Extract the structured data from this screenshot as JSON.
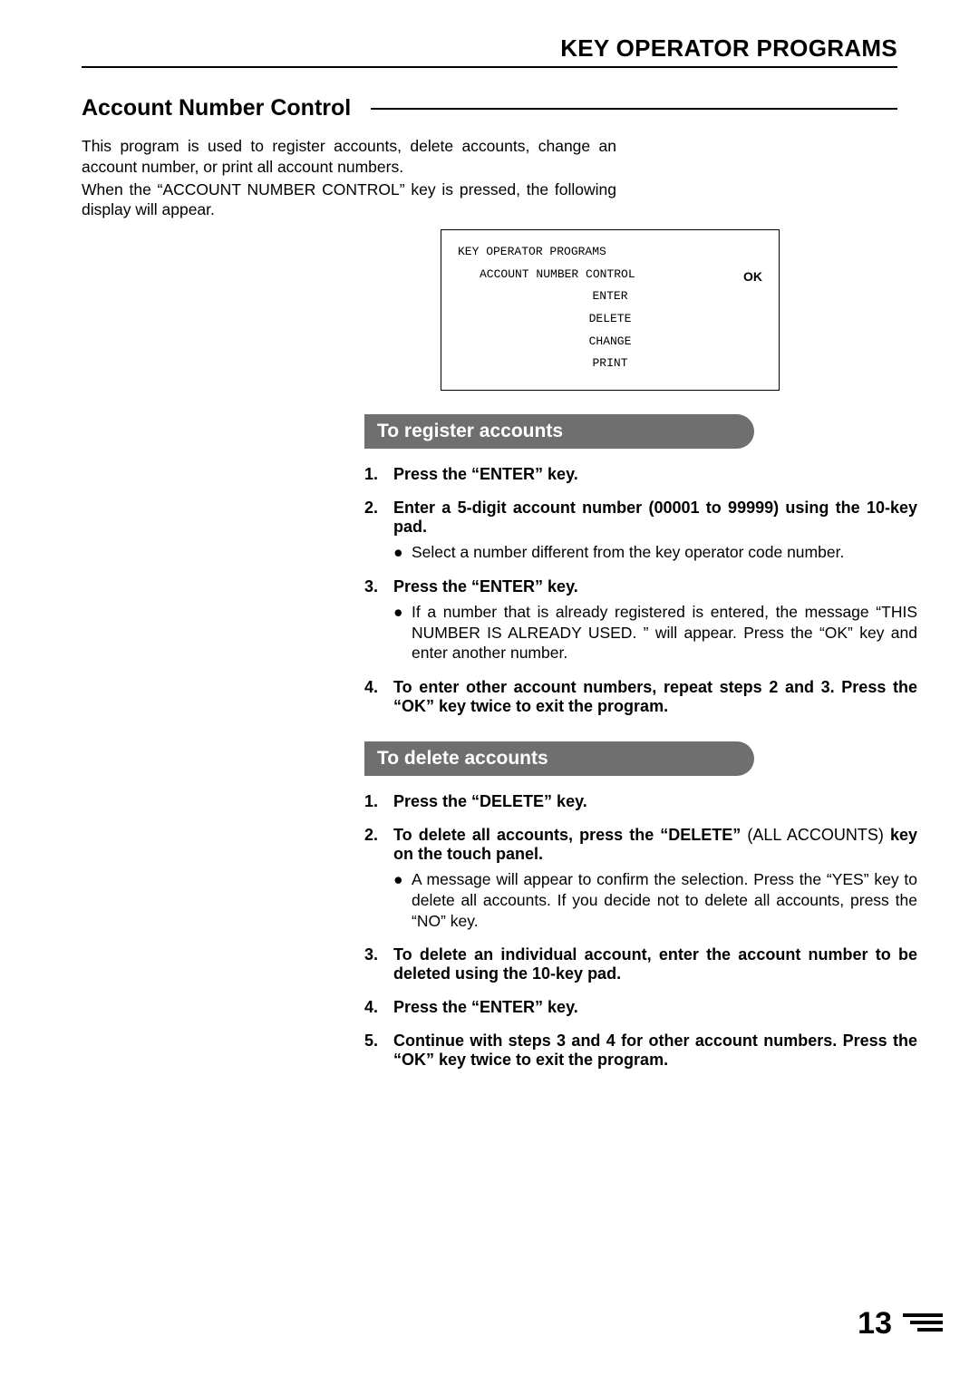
{
  "header": {
    "title": "KEY OPERATOR PROGRAMS"
  },
  "section": {
    "title": "Account Number Control"
  },
  "intro": {
    "p1": "This program is used to register accounts, delete accounts, change an account number, or print all account numbers.",
    "p2": "When the “ACCOUNT NUMBER CONTROL” key is pressed, the following display will appear."
  },
  "display": {
    "line1": "KEY OPERATOR PROGRAMS",
    "line2": "ACCOUNT NUMBER CONTROL",
    "ok": "OK",
    "options": [
      "ENTER",
      "DELETE",
      "CHANGE",
      "PRINT"
    ]
  },
  "register": {
    "heading": "To register accounts",
    "steps": [
      {
        "num": "1.",
        "text_bold": "Press the “ENTER” key."
      },
      {
        "num": "2.",
        "text_bold": "Enter a 5-digit account number (00001 to 99999) using the 10-key pad.",
        "bullets": [
          "Select a number different from the key operator code number."
        ]
      },
      {
        "num": "3.",
        "text_bold": "Press the “ENTER” key.",
        "bullets": [
          "If a number that is already registered is entered, the message “THIS NUMBER IS ALREADY USED. ” will appear. Press the “OK” key and enter another number."
        ]
      },
      {
        "num": "4.",
        "text_bold": "To enter other account numbers, repeat steps 2 and 3. Press the “OK” key twice to exit the program."
      }
    ]
  },
  "delete": {
    "heading": "To delete accounts",
    "steps": [
      {
        "num": "1.",
        "text_bold": "Press the “DELETE” key."
      },
      {
        "num": "2.",
        "html": "<b>To delete all accounts, press the “DELETE”</b> (ALL ACCOUNTS) <b>key on the touch panel.</b>",
        "bullets": [
          "A message will appear to confirm the selection. Press the “YES” key to delete all accounts. If you decide not to delete all accounts, press the “NO” key."
        ]
      },
      {
        "num": "3.",
        "text_bold": "To delete an individual account, enter the account number to be deleted using the 10-key pad."
      },
      {
        "num": "4.",
        "text_bold": "Press the “ENTER” key."
      },
      {
        "num": "5.",
        "text_bold": "Continue with steps 3 and 4 for other account numbers. Press the “OK” key twice to exit the program."
      }
    ]
  },
  "page_number": "13"
}
